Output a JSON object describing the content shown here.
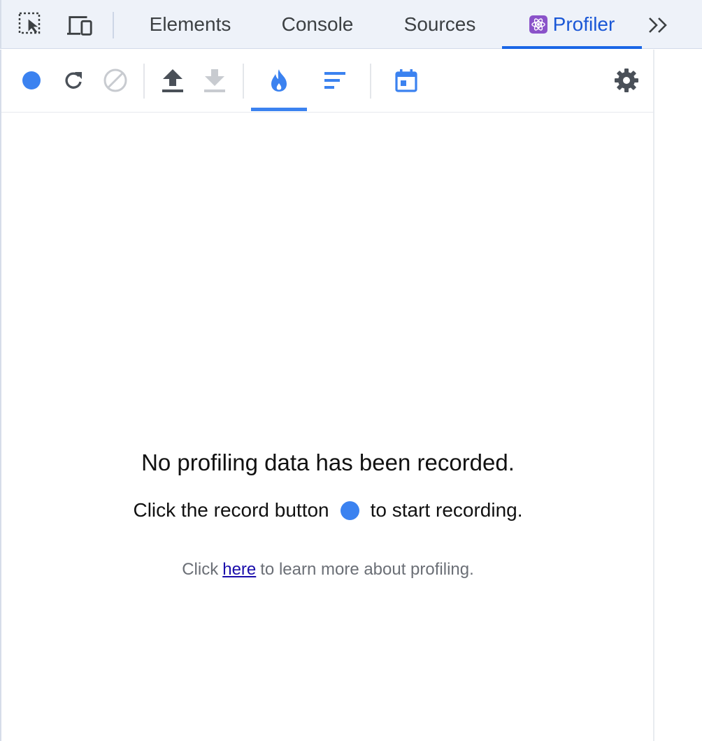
{
  "topbar": {
    "tabs": [
      {
        "label": "Elements"
      },
      {
        "label": "Console"
      },
      {
        "label": "Sources"
      },
      {
        "label": "Profiler",
        "active": true
      }
    ],
    "icons": {
      "inspect": "inspect-element-icon",
      "device": "device-toolbar-icon",
      "more": "chevron-double-right-icon"
    }
  },
  "toolbar": {
    "icons": [
      "record-icon",
      "reload-icon",
      "clear-icon",
      "upload-icon",
      "download-icon",
      "flame-chart-icon",
      "ranked-chart-icon",
      "timeline-icon",
      "settings-icon"
    ]
  },
  "empty_state": {
    "title": "No profiling data has been recorded.",
    "hint_before": "Click the record button",
    "hint_after": "to start recording.",
    "learn_prefix": "Click",
    "learn_link": "here",
    "learn_suffix": "to learn more about profiling."
  },
  "colors": {
    "accent": "#3b82f0",
    "active_tab": "#1a57d6",
    "react_badge": "#8a52c9",
    "disabled_icon": "#c8cbd0",
    "icon": "#4a5058"
  }
}
